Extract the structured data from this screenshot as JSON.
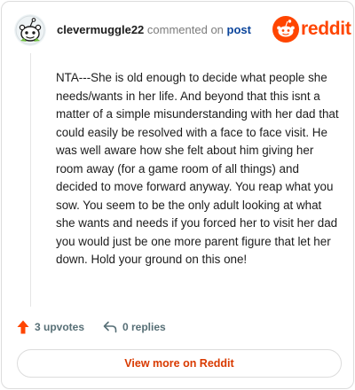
{
  "header": {
    "username": "clevermuggle22",
    "action_text": "commented on",
    "target_link": "post",
    "brand_name": "reddit",
    "brand_color": "#ff4500"
  },
  "comment": {
    "body": "NTA---She is old enough to decide what people she needs/wants in her life. And beyond that this isnt a matter of a simple misunderstanding with her dad that could easily be resolved with a face to face visit. He was well aware how she felt about him giving her room away (for a game room of all things) and decided to move forward anyway. You reap what you sow. You seem to be the only adult looking at what she wants and needs if you forced her to visit her dad you would just be one more parent figure that let her down. Hold your ground on this one!"
  },
  "actions": {
    "upvotes_label": "3 upvotes",
    "replies_label": "0 replies",
    "upvote_icon": "upvote-arrow-icon",
    "reply_icon": "reply-arrow-icon"
  },
  "footer": {
    "view_more_label": "View more on Reddit"
  },
  "colors": {
    "accent": "#ff4500",
    "link": "#0a449b",
    "button_text": "#d93a00",
    "muted": "#576f76"
  }
}
